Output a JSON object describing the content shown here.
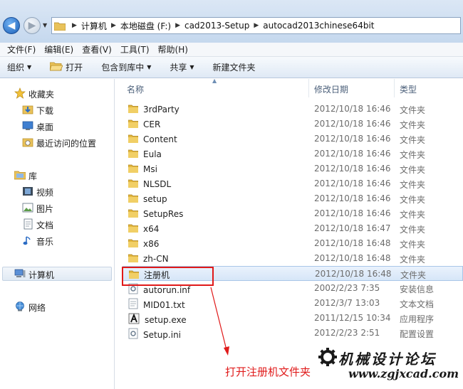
{
  "breadcrumb": [
    "计算机",
    "本地磁盘 (F:)",
    "cad2013-Setup",
    "autocad2013chinese64bit"
  ],
  "menubar": [
    "文件(F)",
    "编辑(E)",
    "查看(V)",
    "工具(T)",
    "帮助(H)"
  ],
  "toolbar": {
    "organize": "组织",
    "open": "打开",
    "include_library": "包含到库中",
    "share": "共享",
    "new_folder": "新建文件夹"
  },
  "nav": {
    "favorites": "收藏夹",
    "downloads": "下载",
    "desktop": "桌面",
    "recent": "最近访问的位置",
    "libraries": "库",
    "videos": "视频",
    "pictures": "图片",
    "documents": "文档",
    "music": "音乐",
    "computer": "计算机",
    "network": "网络"
  },
  "columns": {
    "name": "名称",
    "date": "修改日期",
    "type": "类型"
  },
  "files": [
    {
      "name": "3rdParty",
      "date": "2012/10/18 16:46",
      "type": "文件夹",
      "icon": "folder-icon"
    },
    {
      "name": "CER",
      "date": "2012/10/18 16:46",
      "type": "文件夹",
      "icon": "folder-icon"
    },
    {
      "name": "Content",
      "date": "2012/10/18 16:46",
      "type": "文件夹",
      "icon": "folder-icon"
    },
    {
      "name": "Eula",
      "date": "2012/10/18 16:46",
      "type": "文件夹",
      "icon": "folder-icon"
    },
    {
      "name": "Msi",
      "date": "2012/10/18 16:46",
      "type": "文件夹",
      "icon": "folder-icon"
    },
    {
      "name": "NLSDL",
      "date": "2012/10/18 16:46",
      "type": "文件夹",
      "icon": "folder-icon"
    },
    {
      "name": "setup",
      "date": "2012/10/18 16:46",
      "type": "文件夹",
      "icon": "folder-icon"
    },
    {
      "name": "SetupRes",
      "date": "2012/10/18 16:46",
      "type": "文件夹",
      "icon": "folder-icon"
    },
    {
      "name": "x64",
      "date": "2012/10/18 16:47",
      "type": "文件夹",
      "icon": "folder-icon"
    },
    {
      "name": "x86",
      "date": "2012/10/18 16:48",
      "type": "文件夹",
      "icon": "folder-icon"
    },
    {
      "name": "zh-CN",
      "date": "2012/10/18 16:48",
      "type": "文件夹",
      "icon": "folder-icon"
    },
    {
      "name": "注册机",
      "date": "2012/10/18 16:48",
      "type": "文件夹",
      "icon": "folder-icon",
      "selected": true
    },
    {
      "name": "autorun.inf",
      "date": "2002/2/23 7:35",
      "type": "安装信息",
      "icon": "settings-file-icon"
    },
    {
      "name": "MID01.txt",
      "date": "2012/3/7 13:03",
      "type": "文本文档",
      "icon": "text-file-icon"
    },
    {
      "name": "setup.exe",
      "date": "2011/12/15 10:34",
      "type": "应用程序",
      "icon": "installer-icon"
    },
    {
      "name": "Setup.ini",
      "date": "2012/2/23 2:51",
      "type": "配置设置",
      "icon": "settings-file-icon"
    }
  ],
  "annotation": "打开注册机文件夹",
  "watermark": {
    "title": "机械设计论坛",
    "url": "www.zgjxcad.com"
  },
  "colors": {
    "highlight": "#e01919",
    "annotation": "#e01b1b",
    "selection": "#d6e6f8"
  }
}
